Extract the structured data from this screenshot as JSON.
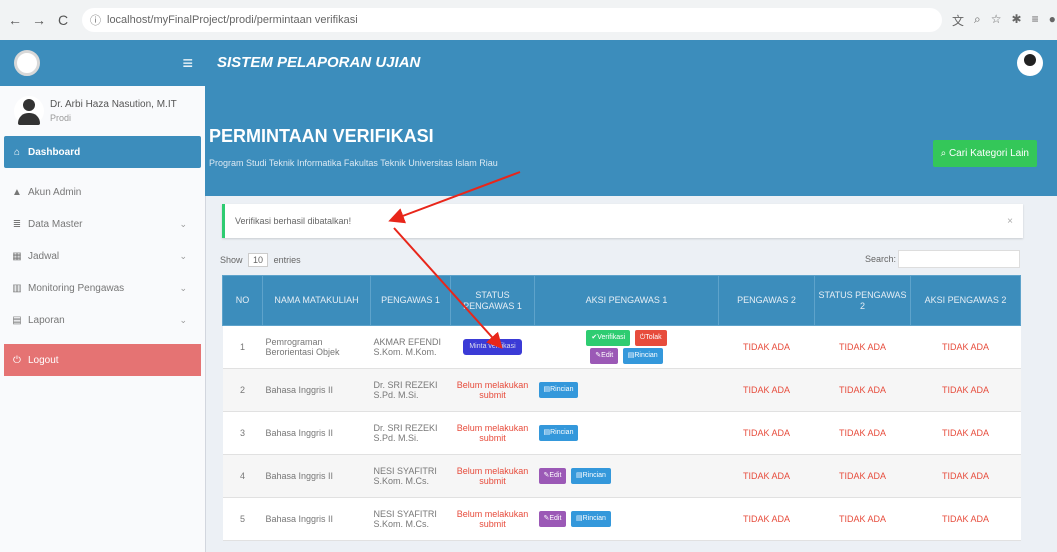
{
  "browser": {
    "url": "localhost/myFinalProject/prodi/permintaan verifikasi"
  },
  "header": {
    "app_title": "SISTEM PELAPORAN UJIAN"
  },
  "sidebar": {
    "user_name": "Dr. Arbi Haza Nasution, M.IT",
    "user_role": "Prodi",
    "items": [
      {
        "label": "Dashboard",
        "icon": "home-icon"
      },
      {
        "label": "Akun Admin",
        "icon": "user-icon"
      },
      {
        "label": "Data Master",
        "icon": "database-icon"
      },
      {
        "label": "Jadwal",
        "icon": "table-icon"
      },
      {
        "label": "Monitoring Pengawas",
        "icon": "monitor-icon"
      },
      {
        "label": "Laporan",
        "icon": "file-icon"
      },
      {
        "label": "Logout",
        "icon": "power-icon"
      }
    ]
  },
  "page": {
    "title": "PERMINTAAN VERIFIKASI",
    "subtitle": "Program Studi Teknik Informatika Fakultas Teknik Universitas Islam Riau",
    "cari_button": "Cari Kategori Lain"
  },
  "alert": {
    "text": "Verifikasi berhasil dibatalkan!",
    "close": "×"
  },
  "table_tools": {
    "show": "Show",
    "entries_value": "10",
    "entries": "entries",
    "search": "Search:"
  },
  "table": {
    "headers": [
      "NO",
      "NAMA MATAKULIAH",
      "PENGAWAS 1",
      "STATUS PENGAWAS 1",
      "AKSI PENGAWAS 1",
      "PENGAWAS 2",
      "STATUS PENGAWAS 2",
      "AKSI PENGAWAS 2"
    ],
    "rows": [
      {
        "no": "1",
        "matakuliah": "Pemrograman Berorientasi Objek",
        "pengawas1": "AKMAR EFENDI S.Kom. M.Kom.",
        "status1": "Minta verifikasi",
        "pengawas2": "TIDAK ADA",
        "status2": "TIDAK ADA",
        "aksi2": "TIDAK ADA"
      },
      {
        "no": "2",
        "matakuliah": "Bahasa Inggris II",
        "pengawas1": "Dr. SRI REZEKI S.Pd. M.Si.",
        "status1": "Belum melakukan submit",
        "pengawas2": "TIDAK ADA",
        "status2": "TIDAK ADA",
        "aksi2": "TIDAK ADA"
      },
      {
        "no": "3",
        "matakuliah": "Bahasa Inggris II",
        "pengawas1": "Dr. SRI REZEKI S.Pd. M.Si.",
        "status1": "Belum melakukan submit",
        "pengawas2": "TIDAK ADA",
        "status2": "TIDAK ADA",
        "aksi2": "TIDAK ADA"
      },
      {
        "no": "4",
        "matakuliah": "Bahasa Inggris II",
        "pengawas1": "NESI SYAFITRI S.Kom. M.Cs.",
        "status1": "Belum melakukan submit",
        "pengawas2": "TIDAK ADA",
        "status2": "TIDAK ADA",
        "aksi2": "TIDAK ADA"
      },
      {
        "no": "5",
        "matakuliah": "Bahasa Inggris II",
        "pengawas1": "NESI SYAFITRI S.Kom. M.Cs.",
        "status1": "Belum melakukan submit",
        "pengawas2": "TIDAK ADA",
        "status2": "TIDAK ADA",
        "aksi2": "TIDAK ADA"
      }
    ],
    "buttons": {
      "verifikasi": "Verifikasi",
      "tolak": "Tolak",
      "edit": "Edit",
      "rincian": "Rincian"
    }
  },
  "colors": {
    "primary": "#3c8dbc",
    "success": "#34c759",
    "danger": "#e74c3c",
    "annotation_arrow": "#e8261a"
  }
}
